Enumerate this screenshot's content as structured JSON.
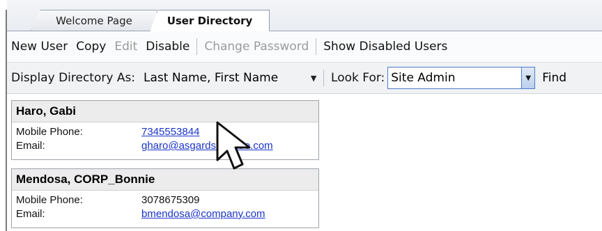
{
  "tabs": [
    {
      "label": "Welcome Page",
      "active": false
    },
    {
      "label": "User Directory",
      "active": true
    }
  ],
  "toolbar": {
    "new_user": "New User",
    "copy": "Copy",
    "edit": "Edit",
    "disable": "Disable",
    "change_password": "Change Password",
    "show_disabled": "Show Disabled Users"
  },
  "filter": {
    "display_label": "Display Directory As:",
    "display_value": "Last Name, First Name",
    "look_for_label": "Look For:",
    "look_for_value": "Site Admin",
    "find": "Find"
  },
  "users": [
    {
      "name": "Haro, Gabi",
      "mobile_label": "Mobile Phone:",
      "mobile": "7345553844",
      "email_label": "Email:",
      "email": "gharo@asgardsoftware.com"
    },
    {
      "name": "Mendosa, CORP_Bonnie",
      "mobile_label": "Mobile Phone:",
      "mobile": "3078675309",
      "email_label": "Email:",
      "email": "bmendosa@company.com"
    }
  ],
  "colors": {
    "link": "#1a33c9",
    "focus_border": "#4a7cc8"
  }
}
